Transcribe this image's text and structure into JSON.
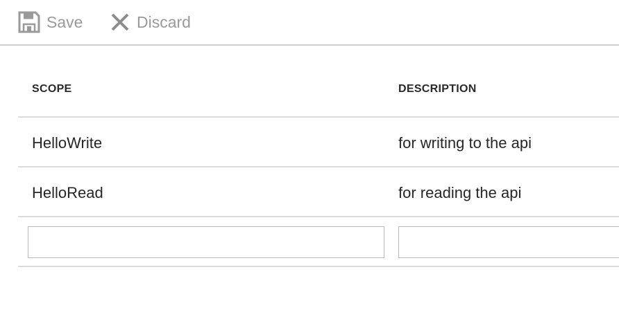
{
  "toolbar": {
    "save_label": "Save",
    "save_icon": "floppy-disk-icon",
    "discard_label": "Discard",
    "discard_icon": "x-close-icon",
    "disabled_color": "#9a9a9a"
  },
  "table": {
    "columns": [
      "SCOPE",
      "DESCRIPTION"
    ],
    "rows": [
      {
        "scope": "HelloWrite",
        "description": "for writing to the api"
      },
      {
        "scope": "HelloRead",
        "description": "for reading the api"
      }
    ],
    "new_row": {
      "scope_value": "",
      "description_value": ""
    }
  }
}
